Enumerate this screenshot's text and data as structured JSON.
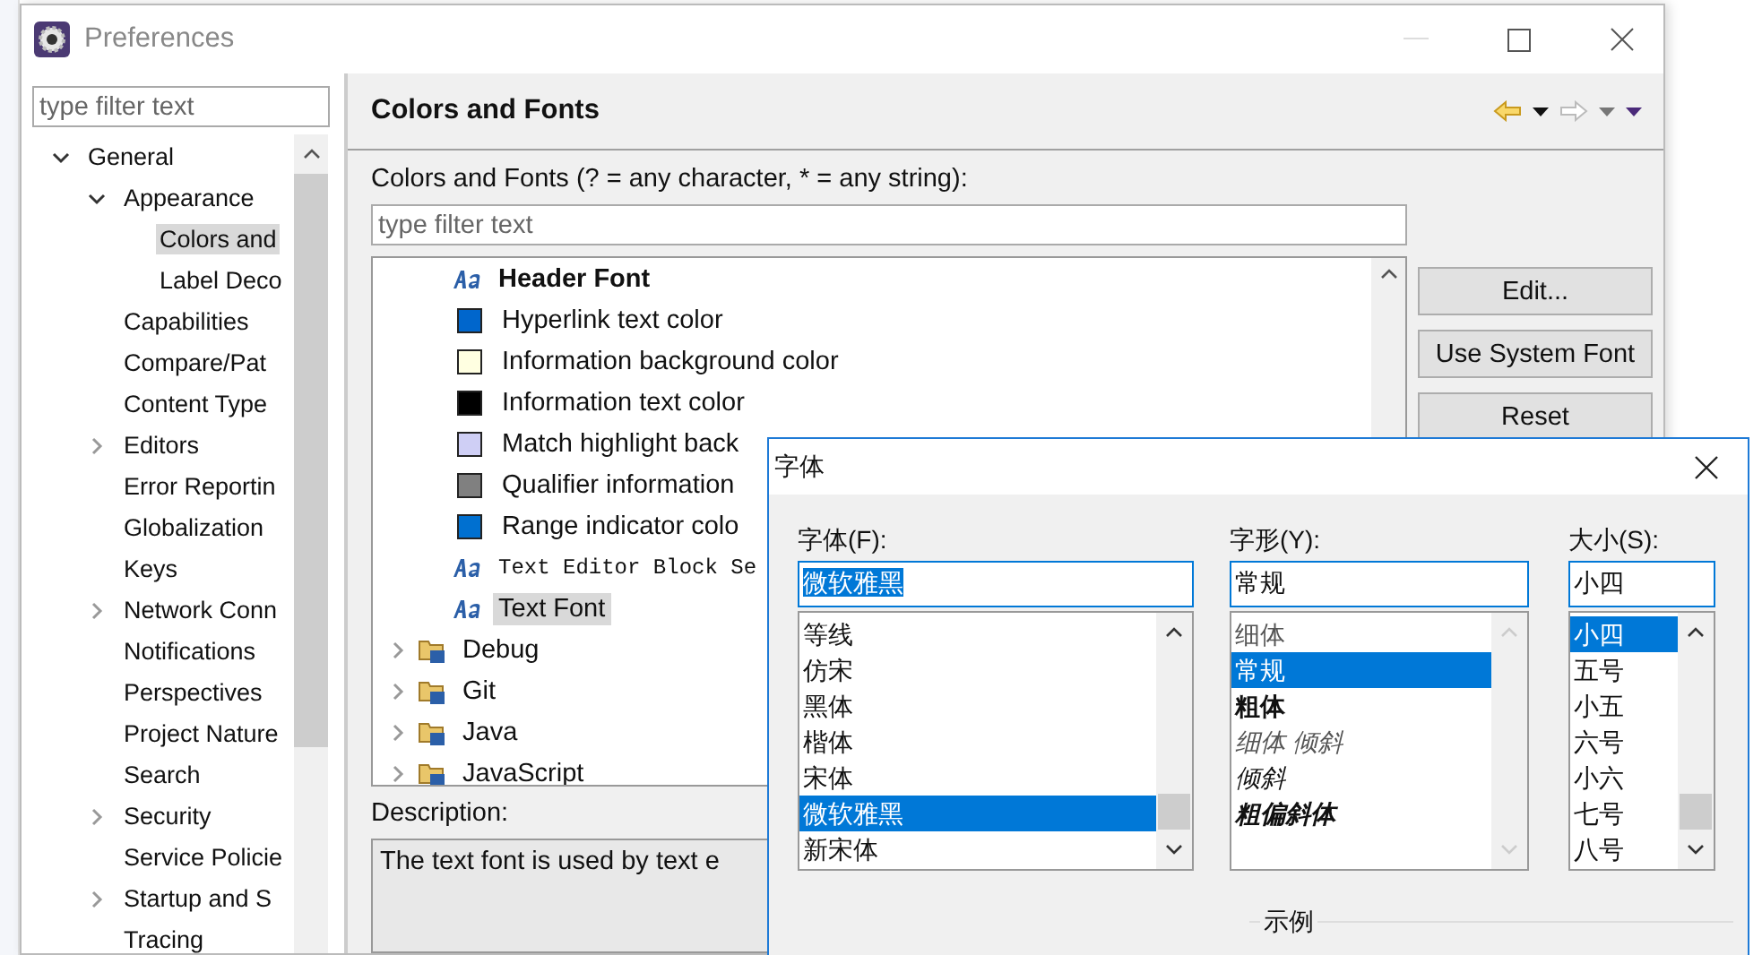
{
  "window": {
    "title": "Preferences"
  },
  "sidebar": {
    "filter": {
      "placeholder": "type filter text"
    },
    "items": [
      {
        "label": "General",
        "expanded": true,
        "selected": false,
        "children": [
          {
            "label": "Appearance",
            "expanded": true,
            "selected": false,
            "children": [
              {
                "label": "Colors and",
                "selected": true
              },
              {
                "label": "Label Deco",
                "selected": false
              }
            ]
          },
          {
            "label": "Capabilities",
            "selected": false
          },
          {
            "label": "Compare/Pat",
            "selected": false
          },
          {
            "label": "Content Type",
            "selected": false
          },
          {
            "label": "Editors",
            "expanded": false,
            "selected": false
          },
          {
            "label": "Error Reportin",
            "selected": false
          },
          {
            "label": "Globalization",
            "selected": false
          },
          {
            "label": "Keys",
            "selected": false
          },
          {
            "label": "Network Conn",
            "expanded": false,
            "selected": false
          },
          {
            "label": "Notifications",
            "selected": false
          },
          {
            "label": "Perspectives",
            "selected": false
          },
          {
            "label": "Project Nature",
            "selected": false
          },
          {
            "label": "Search",
            "selected": false
          },
          {
            "label": "Security",
            "expanded": false,
            "selected": false
          },
          {
            "label": "Service Policie",
            "selected": false
          },
          {
            "label": "Startup and S",
            "expanded": false,
            "selected": false
          },
          {
            "label": "Tracing",
            "selected": false
          }
        ]
      }
    ]
  },
  "page": {
    "title": "Colors and Fonts",
    "filter_label": "Colors and Fonts (? = any character, * = any string):",
    "filter": {
      "placeholder": "type filter text"
    },
    "rows": [
      {
        "kind": "font",
        "label": "Header Font",
        "selected": false
      },
      {
        "kind": "color",
        "label": "Hyperlink text color",
        "color": "#0066cc",
        "selected": false
      },
      {
        "kind": "color",
        "label": "Information background color",
        "color": "#ffffe1",
        "selected": false
      },
      {
        "kind": "color",
        "label": "Information text color",
        "color": "#000000",
        "selected": false
      },
      {
        "kind": "color",
        "label": "Match highlight back",
        "color": "#cfcff5",
        "selected": false
      },
      {
        "kind": "color",
        "label": "Qualifier information",
        "color": "#808080",
        "selected": false
      },
      {
        "kind": "color",
        "label": "Range indicator colo",
        "color": "#0070d0",
        "selected": false
      },
      {
        "kind": "font",
        "label": "Text Editor Block Se",
        "selected": false
      },
      {
        "kind": "font",
        "label": "Text Font",
        "selected": true
      },
      {
        "kind": "category",
        "label": "Debug",
        "expanded": false,
        "selected": false
      },
      {
        "kind": "category",
        "label": "Git",
        "expanded": false,
        "selected": false
      },
      {
        "kind": "category",
        "label": "Java",
        "expanded": false,
        "selected": false
      },
      {
        "kind": "category",
        "label": "JavaScript",
        "expanded": false,
        "selected": false
      }
    ],
    "buttons": [
      "Edit...",
      "Use System Font",
      "Reset"
    ],
    "description_label": "Description:",
    "description": "The text font is used by text e"
  },
  "font_dialog": {
    "title": "字体",
    "font": {
      "label": "字体(F):",
      "value": "微软雅黑",
      "items": [
        {
          "label": "等线",
          "selected": false
        },
        {
          "label": "仿宋",
          "selected": false
        },
        {
          "label": "黑体",
          "selected": false
        },
        {
          "label": "楷体",
          "selected": false
        },
        {
          "label": "宋体",
          "selected": false
        },
        {
          "label": "微软雅黑",
          "selected": true
        },
        {
          "label": "新宋体",
          "selected": false
        }
      ]
    },
    "style": {
      "label": "字形(Y):",
      "value": "常规",
      "items": [
        {
          "label": "细体",
          "selected": false
        },
        {
          "label": "常规",
          "selected": true
        },
        {
          "label": "粗体",
          "selected": false
        },
        {
          "label": "细体 倾斜",
          "selected": false
        },
        {
          "label": "倾斜",
          "selected": false
        },
        {
          "label": "粗偏斜体",
          "selected": false
        }
      ]
    },
    "size": {
      "label": "大小(S):",
      "value": "小四",
      "items": [
        {
          "label": "小四",
          "selected": true
        },
        {
          "label": "五号",
          "selected": false
        },
        {
          "label": "小五",
          "selected": false
        },
        {
          "label": "六号",
          "selected": false
        },
        {
          "label": "小六",
          "selected": false
        },
        {
          "label": "七号",
          "selected": false
        },
        {
          "label": "八号",
          "selected": false
        }
      ]
    },
    "sample_label": "示例"
  }
}
